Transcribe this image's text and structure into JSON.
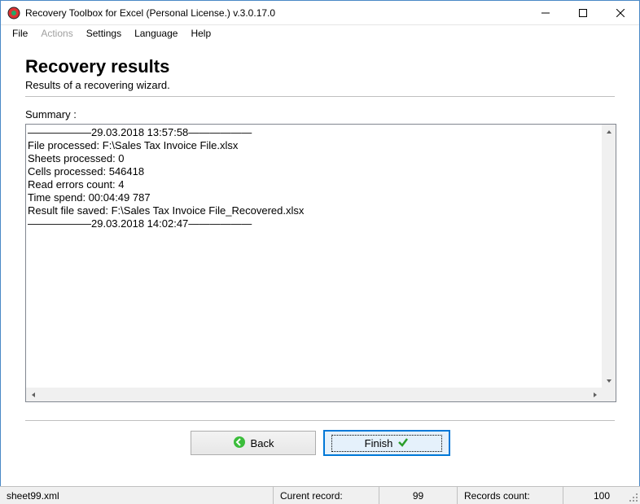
{
  "window": {
    "title": "Recovery Toolbox for Excel (Personal License.) v.3.0.17.0"
  },
  "menu": {
    "file": "File",
    "actions": "Actions",
    "settings": "Settings",
    "language": "Language",
    "help": "Help"
  },
  "page": {
    "title": "Recovery results",
    "subtitle": "Results of a recovering wizard.",
    "summary_label": "Summary :"
  },
  "log": {
    "l0": "——————29.03.2018 13:57:58——————",
    "l1": "File processed: F:\\Sales Tax Invoice File.xlsx",
    "l2": "Sheets processed: 0",
    "l3": "Cells processed: 546418",
    "l4": "Read errors count: 4",
    "l5": "Time spend: 00:04:49 787",
    "l6": "Result file saved: F:\\Sales Tax Invoice File_Recovered.xlsx",
    "l7": "——————29.03.2018 14:02:47——————"
  },
  "buttons": {
    "back": "Back",
    "finish": "Finish"
  },
  "status": {
    "file": "sheet99.xml",
    "current_label": "Curent record:",
    "current_value": "99",
    "records_label": "Records count:",
    "records_value": "100"
  }
}
